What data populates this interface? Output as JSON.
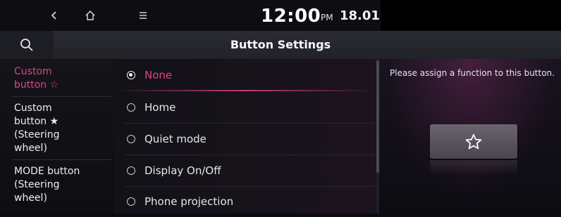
{
  "status_bar": {
    "back_icon": "back-chevron-icon",
    "home_icon": "home-icon",
    "menu_icon": "menu-icon",
    "time": "12:00",
    "ampm": "PM",
    "date": "18.01"
  },
  "header": {
    "search_icon": "search-icon",
    "title": "Button Settings"
  },
  "left_menu": {
    "items": [
      {
        "line1": "Custom",
        "line2": "button ☆",
        "line3": "",
        "line4": ""
      },
      {
        "line1": "Custom",
        "line2": "button ★",
        "line3": "(Steering",
        "line4": "wheel)"
      },
      {
        "line1": "MODE button",
        "line2": "(Steering",
        "line3": "wheel)",
        "line4": ""
      }
    ],
    "active_index": 0
  },
  "options": {
    "items": [
      {
        "label": "None"
      },
      {
        "label": "Home"
      },
      {
        "label": "Quiet mode"
      },
      {
        "label": "Display On/Off"
      },
      {
        "label": "Phone projection"
      }
    ],
    "selected_index": 0
  },
  "info_panel": {
    "text": "Please assign a function to this button.",
    "tile_icon": "star-outline-icon"
  },
  "colors": {
    "accent": "#e0438e",
    "text": "#e9e9ee",
    "background": "#0b0b10"
  }
}
